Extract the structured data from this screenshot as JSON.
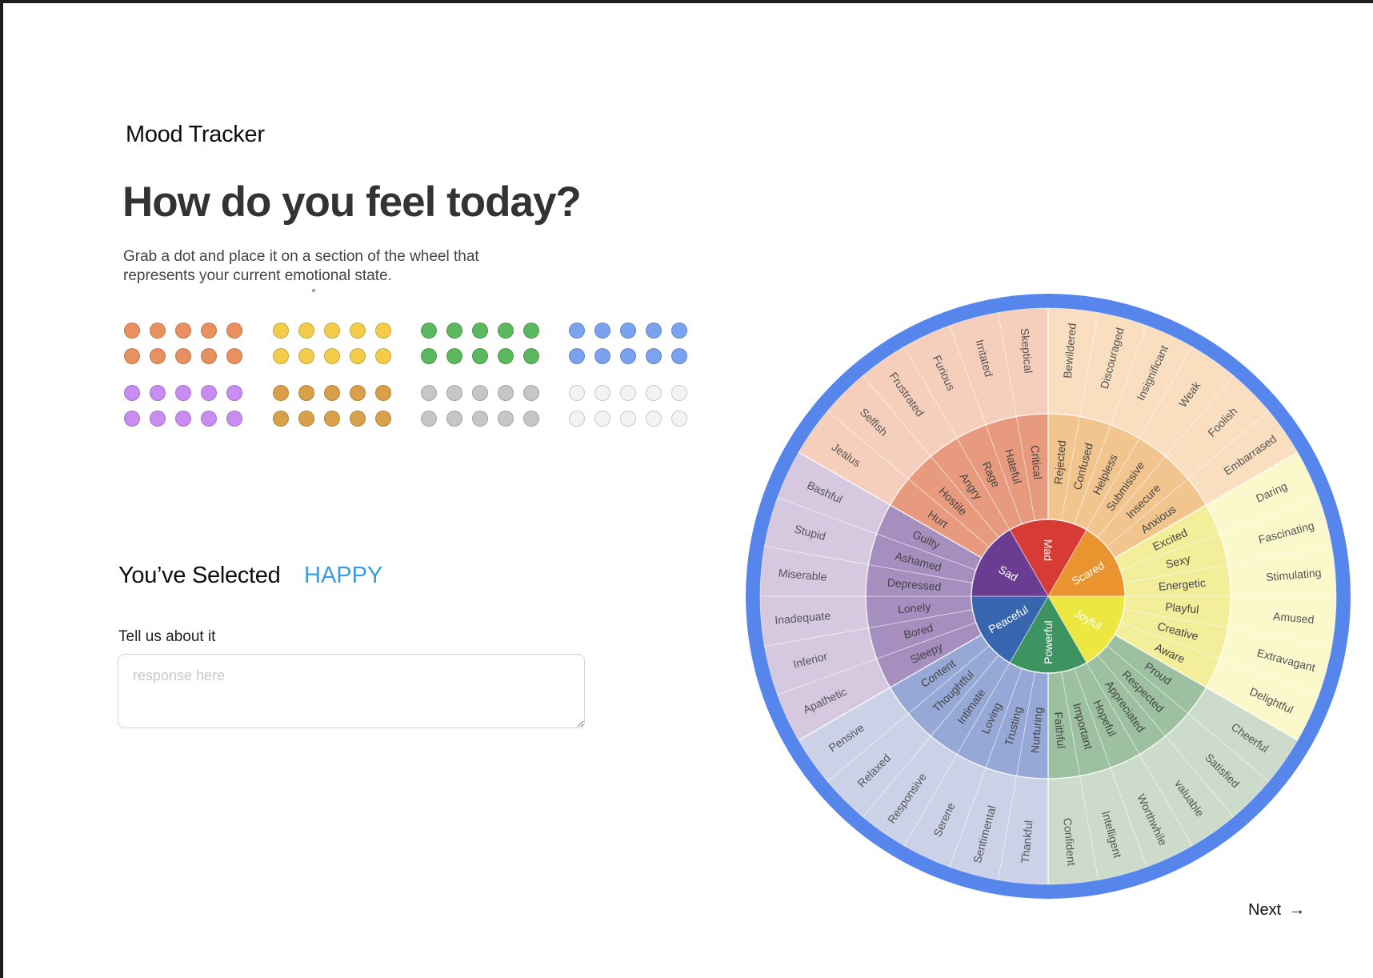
{
  "header": {
    "app_title": "Mood Tracker"
  },
  "main": {
    "headline": "How do you feel today?",
    "instructions": "Grab a dot and place it on a section of the wheel that represents your current emotional state.",
    "selected_label": "You’ve Selected",
    "selected_value": "HAPPY",
    "prompt_label": "Tell us about it",
    "response_placeholder": "response here",
    "response_value": "",
    "next_label": "Next",
    "next_icon": "arrow-right-icon"
  },
  "dot_palette": [
    {
      "color": "#e8905f",
      "count": 10
    },
    {
      "color": "#f2cc4a",
      "count": 10
    },
    {
      "color": "#5cb85f",
      "count": 10
    },
    {
      "color": "#7aa2ef",
      "count": 10
    },
    {
      "color": "#c98cf0",
      "count": 10
    },
    {
      "color": "#d9a04a",
      "count": 10
    },
    {
      "color": "#c6c6c6",
      "count": 10
    },
    {
      "color": "#f3f3f3",
      "count": 10
    }
  ],
  "wheel": {
    "ring_color": "#5686eb",
    "core": [
      {
        "label": "Mad",
        "color": "#d63b36"
      },
      {
        "label": "Scared",
        "color": "#ea9430"
      },
      {
        "label": "Joyful",
        "color": "#ece841"
      },
      {
        "label": "Powerful",
        "color": "#3d9461"
      },
      {
        "label": "Peaceful",
        "color": "#3766ae"
      },
      {
        "label": "Sad",
        "color": "#6a3d93"
      }
    ],
    "middle": [
      {
        "labels": [
          "Hurt",
          "Hostile",
          "Angry",
          "Rage",
          "Hateful",
          "Critical"
        ],
        "color": "#e89a7e"
      },
      {
        "labels": [
          "Rejected",
          "Confused",
          "Helpless",
          "Submissive",
          "Insecure",
          "Anxious"
        ],
        "color": "#f2c48e"
      },
      {
        "labels": [
          "Excited",
          "Sexy",
          "Energetic",
          "Playful",
          "Creative",
          "Aware"
        ],
        "color": "#f2ee9a"
      },
      {
        "labels": [
          "Proud",
          "Respected",
          "Appreciated",
          "Hopeful",
          "Important",
          "Faithful"
        ],
        "color": "#9cc0a0"
      },
      {
        "labels": [
          "Nurturing",
          "Trusting",
          "Loving",
          "Intimate",
          "Thoughtful",
          "Content"
        ],
        "color": "#96a9d6"
      },
      {
        "labels": [
          "Sleepy",
          "Bored",
          "Lonely",
          "Depressed",
          "Ashamed",
          "Guilty"
        ],
        "color": "#a68ebf"
      }
    ],
    "outer": [
      {
        "labels": [
          "Jealus",
          "Selfish",
          "Frustrated",
          "Furious",
          "Irritated",
          "Skeptical"
        ],
        "color": "#f5cfbc"
      },
      {
        "labels": [
          "Bewildered",
          "Discouraged",
          "Insignificant",
          "Weak",
          "Foolish",
          "Embarrased"
        ],
        "color": "#f9dfbf"
      },
      {
        "labels": [
          "Daring",
          "Fascinating",
          "Stimulating",
          "Amused",
          "Extravagant",
          "Delightful"
        ],
        "color": "#fbf8cb"
      },
      {
        "labels": [
          "Cheerful",
          "Satisfied",
          "valuable",
          "Worthwhile",
          "Intelligent",
          "Confident"
        ],
        "color": "#cddbcb"
      },
      {
        "labels": [
          "Thankful",
          "Sentimental",
          "Serene",
          "Responsive",
          "Relaxed",
          "Pensive"
        ],
        "color": "#cbd1e6"
      },
      {
        "labels": [
          "Apathetic",
          "Inferior",
          "Inadequate",
          "Miserable",
          "Stupid",
          "Bashful"
        ],
        "color": "#d5c8df"
      }
    ]
  }
}
